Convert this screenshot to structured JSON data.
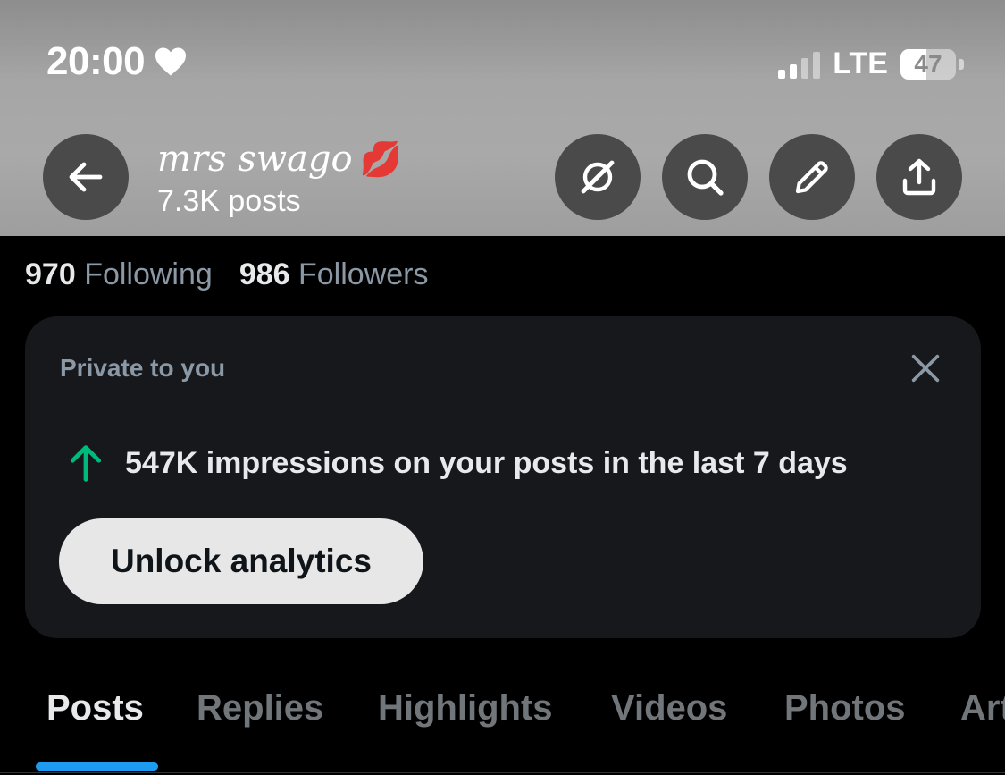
{
  "status_bar": {
    "time": "20:00",
    "network": "LTE",
    "battery": "47",
    "battery_level": 0.47,
    "heart_icon": "heart-icon"
  },
  "profile": {
    "name": "mrs swago",
    "name_emoji": "💋",
    "posts": "7.3K posts"
  },
  "header_actions": {
    "back_icon": "arrow-left-icon",
    "grok_icon": "grok-slash-icon",
    "search_icon": "search-icon",
    "edit_icon": "pencil-icon",
    "share_icon": "share-icon"
  },
  "stats": {
    "following_count": "970",
    "following_label": "Following",
    "followers_count": "986",
    "followers_label": "Followers"
  },
  "analytics_card": {
    "private_label": "Private to you",
    "stat_text": "547K impressions on your posts in the last 7 days",
    "button_label": "Unlock analytics",
    "arrow_color": "#00ba7c"
  },
  "tabs": [
    {
      "label": "Posts",
      "active": true
    },
    {
      "label": "Replies",
      "active": false
    },
    {
      "label": "Highlights",
      "active": false
    },
    {
      "label": "Videos",
      "active": false
    },
    {
      "label": "Photos",
      "active": false
    },
    {
      "label": "Articles",
      "active": false
    }
  ],
  "colors": {
    "accent": "#1d9bf0",
    "background": "#000000",
    "card": "#16181c",
    "muted_text": "#8b98a5"
  }
}
